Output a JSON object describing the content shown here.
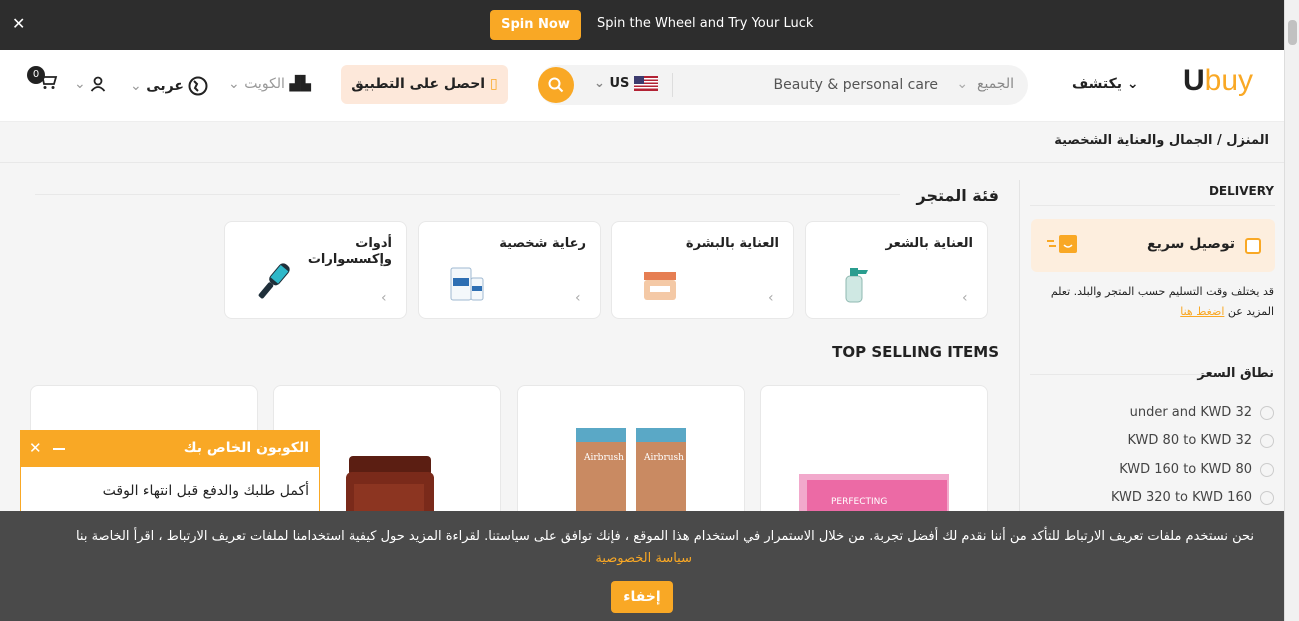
{
  "promo": {
    "spin_label": "Spin Now",
    "text": "Spin the Wheel and Try Your Luck"
  },
  "header": {
    "logo_u": "U",
    "logo_rest": "buy",
    "explore": "يكتشف",
    "search_category": "الجميع",
    "search_value": "Beauty & personal care",
    "country": "US",
    "app_button": "احصل على التطبيق",
    "location": "الكويت",
    "language": "عربى",
    "cart_count": "0"
  },
  "breadcrumb": "المنزل / الجمال والعناية الشخصية",
  "sidebar": {
    "delivery_heading": "DELIVERY",
    "fast_delivery": "توصيل سريع",
    "note": "قد يختلف وقت التسليم حسب المتجر والبلد. تعلم المزيد عن",
    "note_link": "اضغط هنا",
    "price_heading": "نطاق السعر",
    "price_options": [
      "under  and KWD 32",
      "KWD 80 to KWD 32",
      "KWD 160 to KWD 80",
      "KWD 320 to KWD 160"
    ]
  },
  "main": {
    "category_heading": "فئة المتجر",
    "categories": [
      {
        "name": "العناية بالشعر"
      },
      {
        "name": "العناية بالبشرة"
      },
      {
        "name": "رعاية شخصية"
      },
      {
        "name": "أدوات وإكسسوارات"
      }
    ],
    "top_heading": "TOP SELLING ITEMS"
  },
  "coupon": {
    "title": "الكوبون الخاص بك",
    "body": "أكمل طلبك والدفع قبل انتهاء الوقت"
  },
  "cookie": {
    "message": "نحن نستخدم ملفات تعريف الارتباط للتأكد من أننا نقدم لك أفضل تجربة. من خلال الاستمرار في استخدام هذا الموقع ، فإنك توافق على سياستنا. لقراءة المزيد حول كيفية استخدامنا لملفات تعريف الارتباط ، اقرأ الخاصة بنا",
    "link": "سياسة الخصوصية",
    "hide": "إخفاء"
  },
  "colors": {
    "accent": "#f9a825",
    "dark": "#2d2d2d"
  }
}
